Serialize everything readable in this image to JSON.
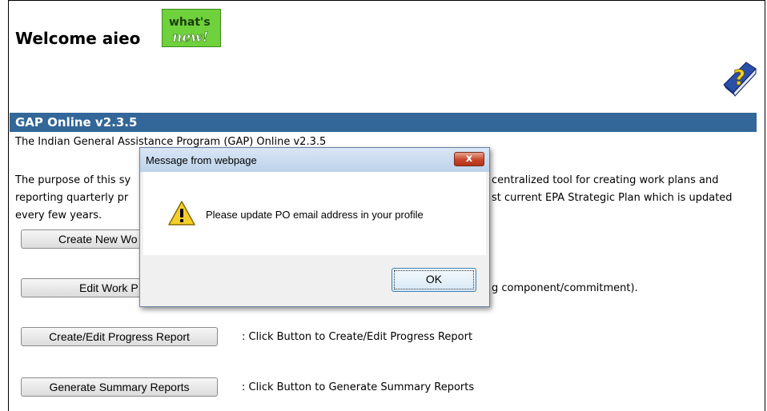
{
  "header": {
    "welcome_text": "Welcome aieo",
    "whatsnew_top": "what's",
    "whatsnew_bottom": "new!"
  },
  "banner": {
    "title": "GAP Online v2.3.5"
  },
  "intro": {
    "line1_left": "The Indian General Assistance Program (GAP) Online v2.3.5",
    "purpose_l1_left": "The purpose of this sy",
    "purpose_l1_right": "centralized tool for creating work plans and",
    "purpose_l2_left": "reporting quarterly pr",
    "purpose_l2_right": "st current EPA Strategic Plan which is updated",
    "purpose_l3": "every few years."
  },
  "actions": [
    {
      "label": "Create New Wo",
      "desc": ""
    },
    {
      "label": "Edit Work P",
      "desc": "g component/commitment)."
    },
    {
      "label": "Create/Edit Progress Report",
      "desc": ": Click Button to Create/Edit Progress Report"
    },
    {
      "label": "Generate Summary Reports",
      "desc": ": Click Button to Generate Summary Reports"
    }
  ],
  "dialog": {
    "title": "Message from webpage",
    "close_glyph": "x",
    "message": "Please update PO email address in your profile",
    "ok_label": "OK"
  },
  "colors": {
    "banner": "#336699",
    "whatsnew": "#6fd13c"
  }
}
